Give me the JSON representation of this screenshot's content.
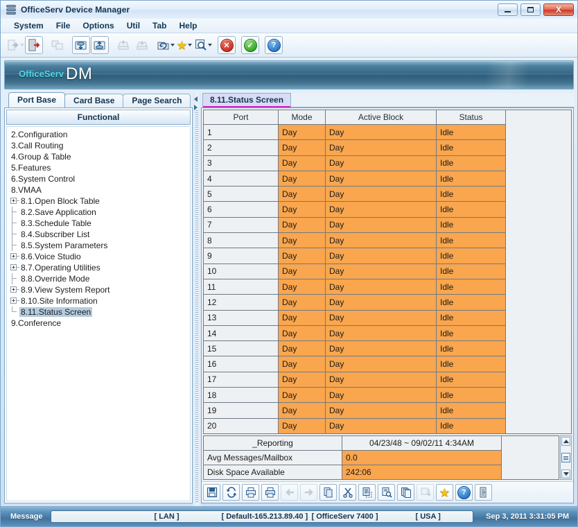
{
  "window": {
    "title": "OfficeServ Device Manager",
    "minimize_label": "Minimize",
    "maximize_label": "Maximize",
    "close_label": "X"
  },
  "menu": {
    "items": [
      {
        "label": "System"
      },
      {
        "label": "File"
      },
      {
        "label": "Options"
      },
      {
        "label": "Util"
      },
      {
        "label": "Tab"
      },
      {
        "label": "Help"
      }
    ]
  },
  "toolbar": {
    "buttons": [
      {
        "name": "login-button",
        "icon": "login-arrow-icon",
        "enabled": false,
        "has_caret": true
      },
      {
        "name": "logout-button",
        "icon": "logout-door-icon",
        "enabled": true,
        "has_caret": false
      },
      {
        "name": "device-list-button",
        "icon": "devices-icon",
        "enabled": false,
        "has_caret": false
      },
      {
        "name": "upload-db-button",
        "icon": "upload-db-icon",
        "enabled": true,
        "has_caret": false
      },
      {
        "name": "download-db-button",
        "icon": "download-db-icon",
        "enabled": true,
        "has_caret": false
      },
      {
        "name": "export-button",
        "icon": "export-tray-icon",
        "enabled": false,
        "has_caret": false
      },
      {
        "name": "import-button",
        "icon": "import-tray-icon",
        "enabled": false,
        "has_caret": false
      },
      {
        "name": "refresh-button",
        "icon": "refresh-folder-icon",
        "enabled": true,
        "has_caret": true
      },
      {
        "name": "favorites-button",
        "icon": "star-icon",
        "enabled": true,
        "has_caret": true
      },
      {
        "name": "search-button",
        "icon": "magnifier-icon",
        "enabled": true,
        "has_caret": true
      },
      {
        "name": "cancel-button",
        "icon": "red-x-circle-icon",
        "enabled": true,
        "has_caret": false
      },
      {
        "name": "apply-button",
        "icon": "green-check-circle-icon",
        "enabled": true,
        "has_caret": false
      },
      {
        "name": "help-button",
        "icon": "blue-question-circle-icon",
        "enabled": true,
        "has_caret": false
      }
    ]
  },
  "banner": {
    "brand": "OfficeServ",
    "product": "DM"
  },
  "left_panel": {
    "tabs": [
      {
        "label": "Port Base",
        "active": true
      },
      {
        "label": "Card Base",
        "active": false
      },
      {
        "label": "Page Search",
        "active": false
      }
    ],
    "header": "Functional",
    "tree": [
      {
        "label": "2.Configuration",
        "indent": 0,
        "marker": "none",
        "selected": false
      },
      {
        "label": "3.Call Routing",
        "indent": 0,
        "marker": "none",
        "selected": false
      },
      {
        "label": "4.Group & Table",
        "indent": 0,
        "marker": "none",
        "selected": false
      },
      {
        "label": "5.Features",
        "indent": 0,
        "marker": "none",
        "selected": false
      },
      {
        "label": "6.System Control",
        "indent": 0,
        "marker": "none",
        "selected": false
      },
      {
        "label": "8.VMAA",
        "indent": 0,
        "marker": "none",
        "selected": false
      },
      {
        "label": "8.1.Open Block Table",
        "indent": 1,
        "marker": "plus",
        "selected": false
      },
      {
        "label": "8.2.Save Application",
        "indent": 1,
        "marker": "dash",
        "selected": false
      },
      {
        "label": "8.3.Schedule Table",
        "indent": 1,
        "marker": "dash",
        "selected": false
      },
      {
        "label": "8.4.Subscriber List",
        "indent": 1,
        "marker": "dash",
        "selected": false
      },
      {
        "label": "8.5.System Parameters",
        "indent": 1,
        "marker": "dash",
        "selected": false
      },
      {
        "label": "8.6.Voice Studio",
        "indent": 1,
        "marker": "plus",
        "selected": false
      },
      {
        "label": "8.7.Operating Utilities",
        "indent": 1,
        "marker": "plus",
        "selected": false
      },
      {
        "label": "8.8.Override Mode",
        "indent": 1,
        "marker": "dash",
        "selected": false
      },
      {
        "label": "8.9.View System Report",
        "indent": 1,
        "marker": "plus",
        "selected": false
      },
      {
        "label": "8.10.Site Information",
        "indent": 1,
        "marker": "plus",
        "selected": false
      },
      {
        "label": "8.11.Status Screen",
        "indent": 1,
        "marker": "last",
        "selected": true
      },
      {
        "label": "9.Conference",
        "indent": 0,
        "marker": "none",
        "selected": false
      }
    ]
  },
  "right_panel": {
    "tabs": [
      {
        "label": "8.11.Status Screen",
        "active": true
      }
    ],
    "grid": {
      "columns": [
        "Port",
        "Mode",
        "Active Block",
        "Status"
      ],
      "rows": [
        [
          "1",
          "Day",
          "Day",
          "Idle"
        ],
        [
          "2",
          "Day",
          "Day",
          "Idle"
        ],
        [
          "3",
          "Day",
          "Day",
          "Idle"
        ],
        [
          "4",
          "Day",
          "Day",
          "Idle"
        ],
        [
          "5",
          "Day",
          "Day",
          "Idle"
        ],
        [
          "6",
          "Day",
          "Day",
          "Idle"
        ],
        [
          "7",
          "Day",
          "Day",
          "Idle"
        ],
        [
          "8",
          "Day",
          "Day",
          "Idle"
        ],
        [
          "9",
          "Day",
          "Day",
          "Idle"
        ],
        [
          "10",
          "Day",
          "Day",
          "Idle"
        ],
        [
          "11",
          "Day",
          "Day",
          "Idle"
        ],
        [
          "12",
          "Day",
          "Day",
          "Idle"
        ],
        [
          "13",
          "Day",
          "Day",
          "Idle"
        ],
        [
          "14",
          "Day",
          "Day",
          "Idle"
        ],
        [
          "15",
          "Day",
          "Day",
          "Idle"
        ],
        [
          "16",
          "Day",
          "Day",
          "Idle"
        ],
        [
          "17",
          "Day",
          "Day",
          "Idle"
        ],
        [
          "18",
          "Day",
          "Day",
          "Idle"
        ],
        [
          "19",
          "Day",
          "Day",
          "Idle"
        ],
        [
          "20",
          "Day",
          "Day",
          "Idle"
        ]
      ]
    },
    "reporting": {
      "title": "_Reporting",
      "range": "04/23/48 ~ 09/02/11 4:34AM",
      "rows": [
        {
          "label": "Avg Messages/Mailbox",
          "value": "0.0"
        },
        {
          "label": "Disk Space Available",
          "value": "242:06"
        }
      ]
    },
    "bottom_toolbar": {
      "buttons": [
        {
          "name": "save-button",
          "icon": "floppy-disk-icon",
          "enabled": true
        },
        {
          "name": "refresh-button",
          "icon": "refresh-arrows-icon",
          "enabled": true
        },
        {
          "name": "print-preview-button",
          "icon": "printer-preview-icon",
          "enabled": true
        },
        {
          "name": "print-button",
          "icon": "printer-icon",
          "enabled": true
        },
        {
          "name": "back-button",
          "icon": "arrow-left-icon",
          "enabled": false
        },
        {
          "name": "forward-button",
          "icon": "arrow-right-icon",
          "enabled": false
        },
        {
          "name": "copy-button",
          "icon": "copy-pages-icon",
          "enabled": true
        },
        {
          "name": "cut-button",
          "icon": "scissors-icon",
          "enabled": true
        },
        {
          "name": "paste-button",
          "icon": "paste-icon",
          "enabled": true
        },
        {
          "name": "find-button",
          "icon": "document-search-icon",
          "enabled": true
        },
        {
          "name": "duplicate-button",
          "icon": "duplicate-pages-icon",
          "enabled": true
        },
        {
          "name": "sort-button",
          "icon": "sort-descending-icon",
          "enabled": false
        },
        {
          "name": "favorite-button",
          "icon": "star-icon",
          "enabled": true
        },
        {
          "name": "help-button",
          "icon": "blue-question-circle-icon",
          "enabled": true
        },
        {
          "name": "exit-button",
          "icon": "exit-door-icon",
          "enabled": true
        }
      ]
    }
  },
  "statusbar": {
    "message_label": "Message",
    "lan": "[ LAN ]",
    "default_ip": "[ Default-165.213.89.40 ]",
    "system": "[ OfficeServ 7400 ]",
    "country": "[ USA ]",
    "timestamp": "Sep 3, 2011 3:31:05 PM"
  },
  "colors": {
    "accent_orange": "#f9a64e",
    "tab_underline": "#cc22cc",
    "banner_brand": "#4fd8ea",
    "selection": "#b6cce0"
  }
}
